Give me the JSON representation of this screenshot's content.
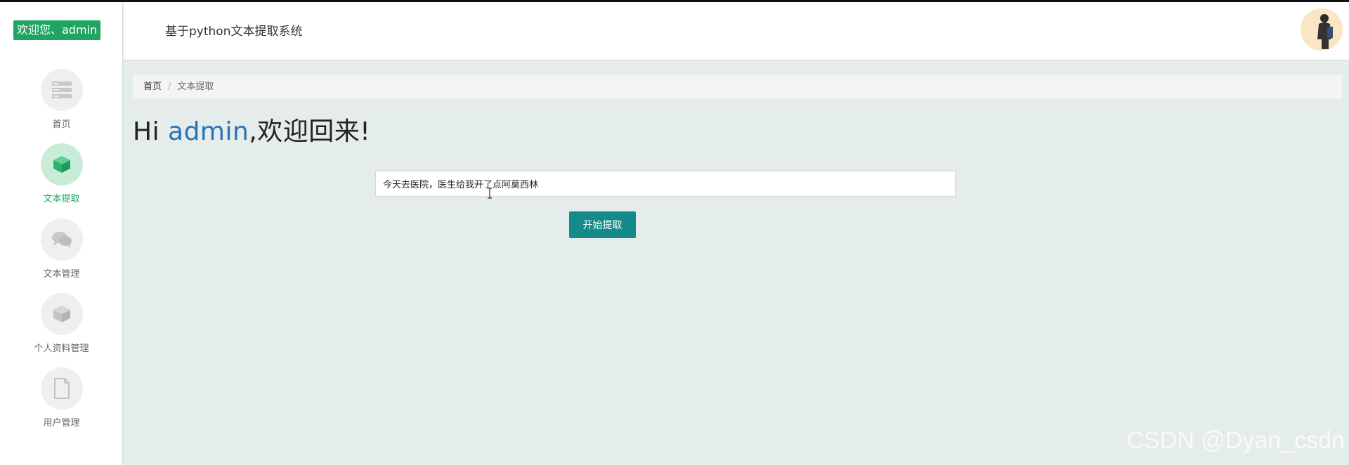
{
  "sidebar": {
    "welcome": "欢迎您、admin",
    "items": [
      {
        "label": "首页",
        "icon": "server-icon",
        "active": false
      },
      {
        "label": "文本提取",
        "icon": "cube-icon",
        "active": true
      },
      {
        "label": "文本管理",
        "icon": "chat-bubbles-icon",
        "active": false
      },
      {
        "label": "个人资料管理",
        "icon": "cube-outline-icon",
        "active": false
      },
      {
        "label": "用户管理",
        "icon": "document-icon",
        "active": false
      }
    ]
  },
  "header": {
    "title": "基于python文本提取系统"
  },
  "breadcrumb": {
    "home": "首页",
    "separator": "/",
    "current": "文本提取"
  },
  "greeting": {
    "prefix": "Hi ",
    "name": "admin",
    "suffix": ",欢迎回来!"
  },
  "form": {
    "input_value": "今天去医院，医生给我开了点阿莫西林",
    "button_label": "开始提取"
  },
  "watermark": "CSDN @Dyan_csdn",
  "colors": {
    "accent_green": "#1fa462",
    "button_teal": "#148a8a",
    "name_blue": "#2b72b4"
  }
}
